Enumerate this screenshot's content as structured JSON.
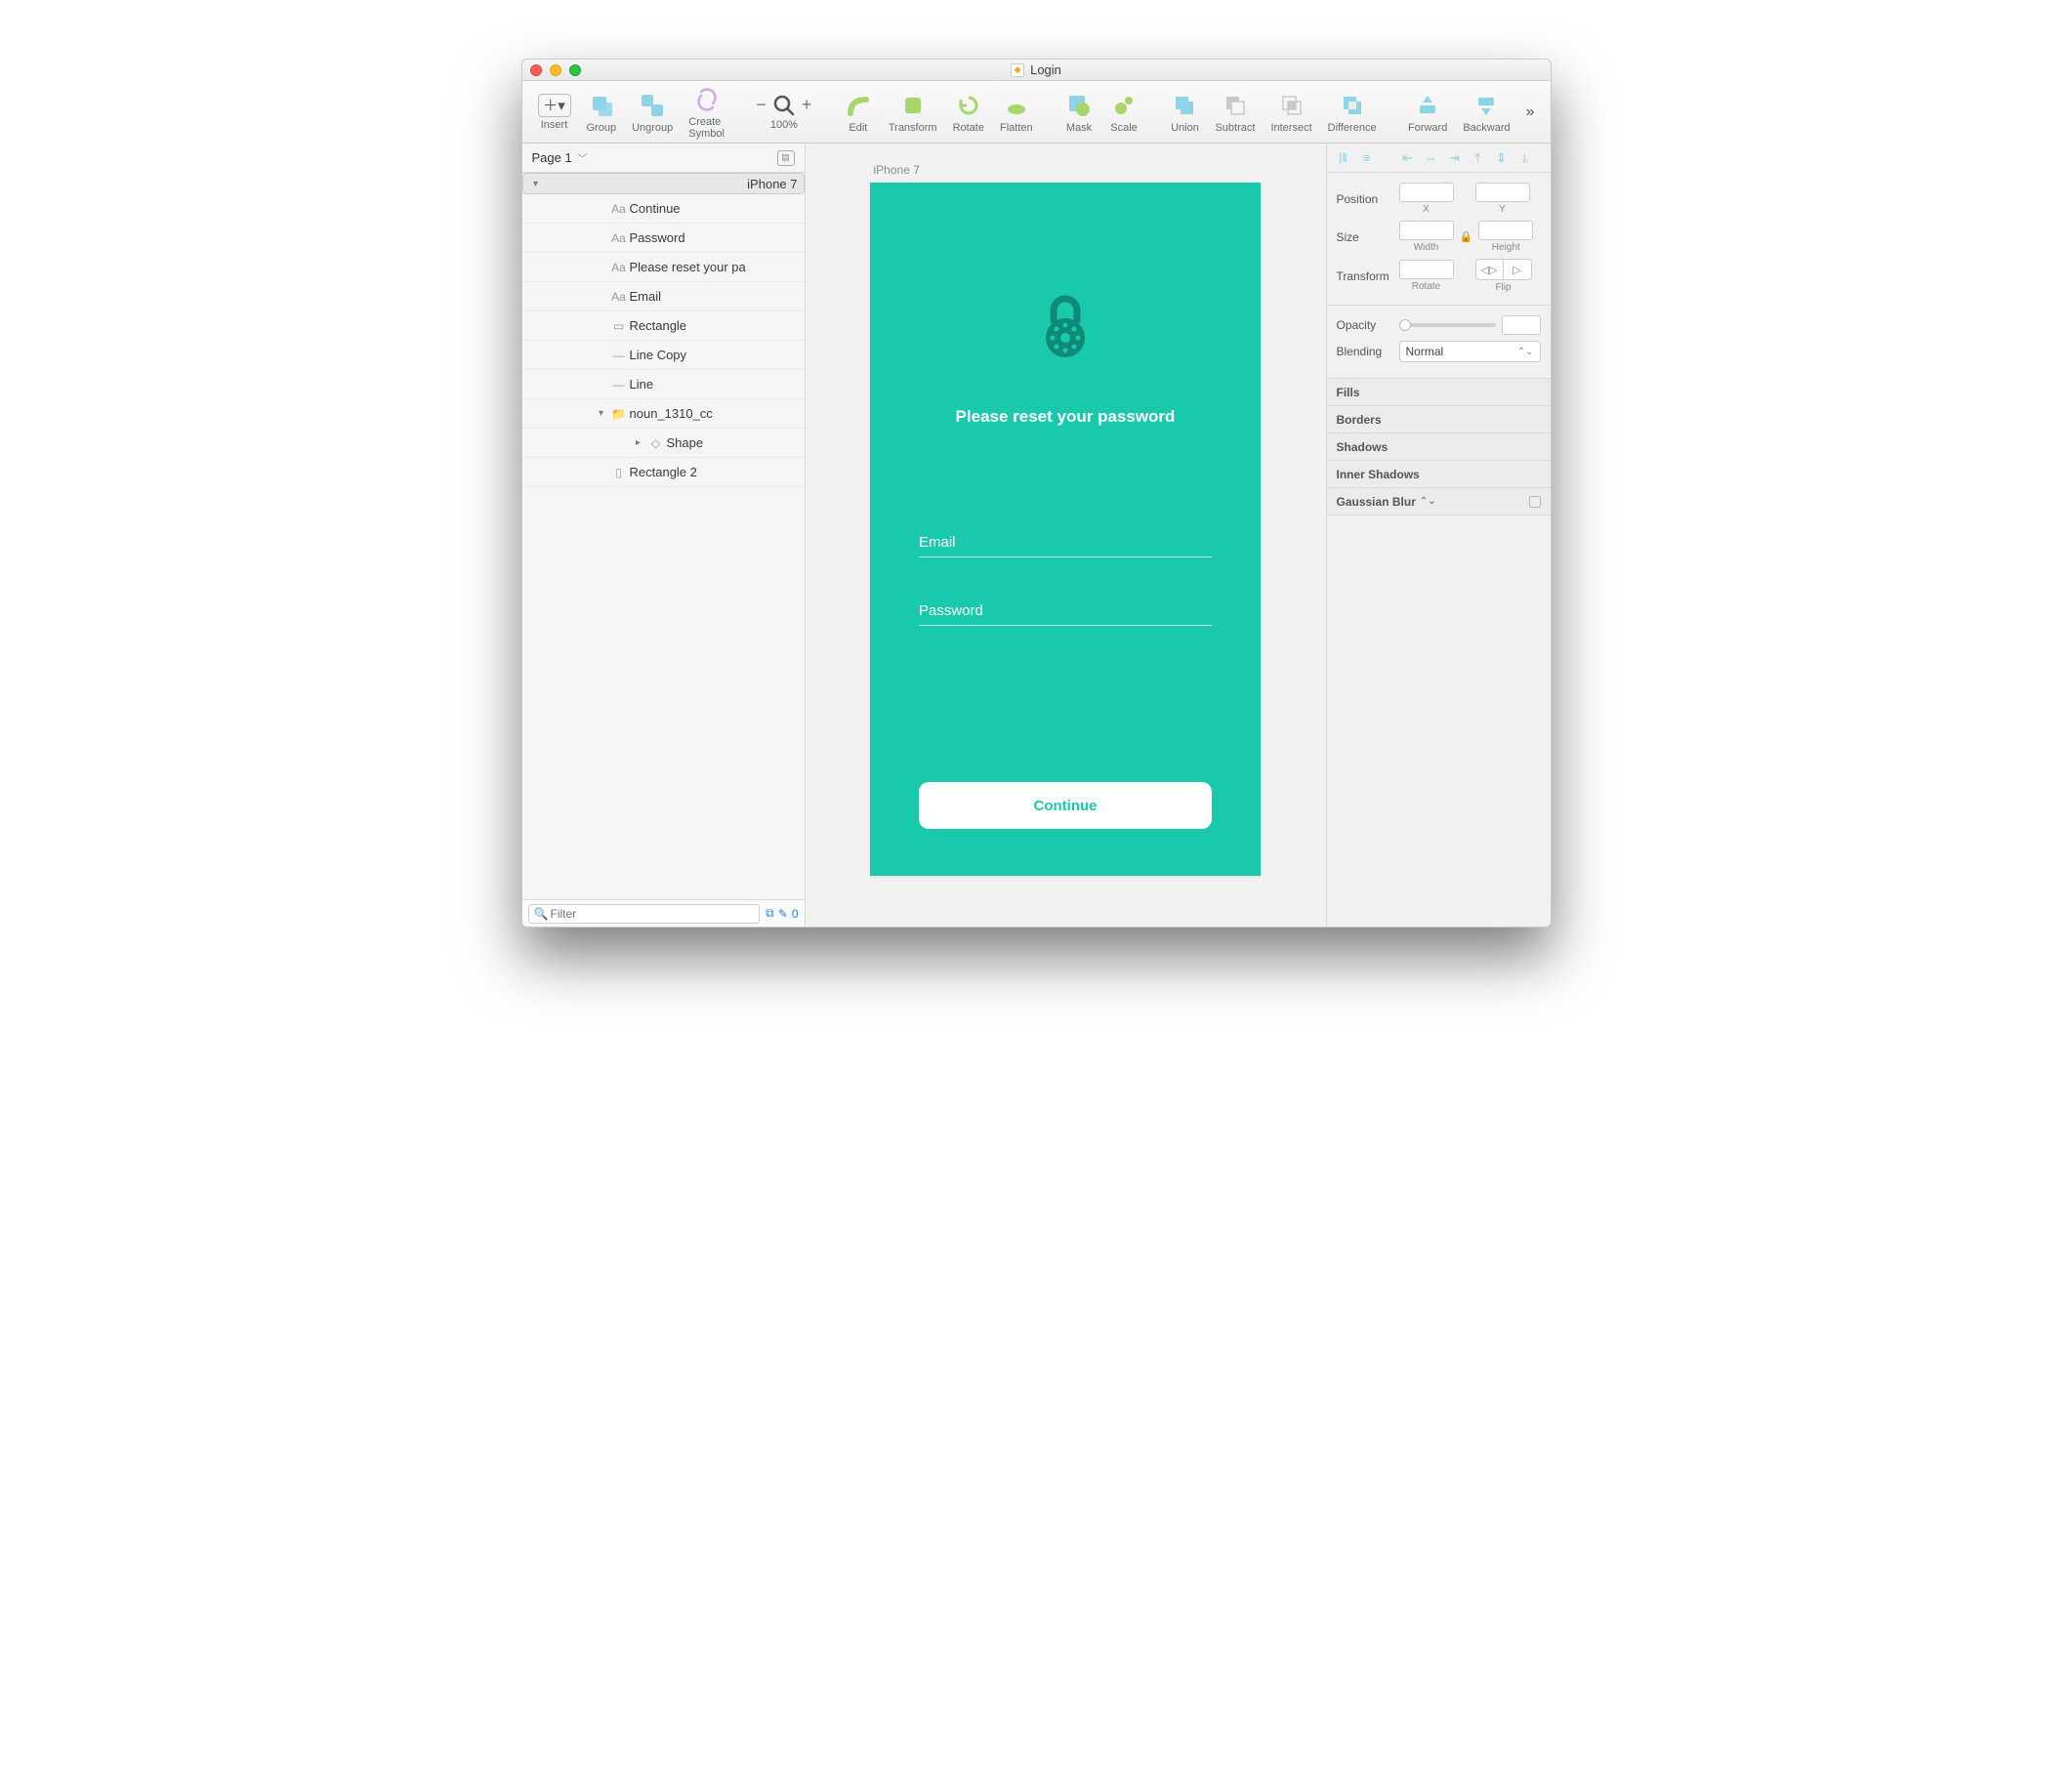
{
  "window": {
    "title": "Login"
  },
  "toolbar": {
    "items": [
      "Insert",
      "Group",
      "Ungroup",
      "Create Symbol"
    ],
    "zoom": "100%",
    "items2": [
      "Edit",
      "Transform",
      "Rotate",
      "Flatten"
    ],
    "items3": [
      "Mask",
      "Scale"
    ],
    "items4": [
      "Union",
      "Subtract",
      "Intersect",
      "Difference"
    ],
    "items5": [
      "Forward",
      "Backward"
    ]
  },
  "pages": {
    "current": "Page 1"
  },
  "layers": [
    {
      "label": "iPhone 7",
      "type": "artboard",
      "depth": 0,
      "disc": "▾"
    },
    {
      "label": "Continue",
      "type": "text",
      "depth": 1
    },
    {
      "label": "Password",
      "type": "text",
      "depth": 1
    },
    {
      "label": "Please reset your pa",
      "type": "text",
      "depth": 1
    },
    {
      "label": "Email",
      "type": "text",
      "depth": 1
    },
    {
      "label": "Rectangle",
      "type": "shape",
      "depth": 1,
      "icon": "▭"
    },
    {
      "label": "Line Copy",
      "type": "shape",
      "depth": 1,
      "icon": "—"
    },
    {
      "label": "Line",
      "type": "shape",
      "depth": 1,
      "icon": "—"
    },
    {
      "label": "noun_1310_cc",
      "type": "folder",
      "depth": 1,
      "disc": "▾"
    },
    {
      "label": "Shape",
      "type": "shape",
      "depth": 2,
      "disc": "▸",
      "icon": "◇"
    },
    {
      "label": "Rectangle 2",
      "type": "shape",
      "depth": 1,
      "icon": "▯"
    }
  ],
  "filter": {
    "placeholder": "Filter",
    "count": "0"
  },
  "canvas": {
    "artboard_label": "iPhone 7",
    "heading": "Please reset your password",
    "field_email": "Email",
    "field_password": "Password",
    "cta": "Continue"
  },
  "inspector": {
    "position": "Position",
    "x": "X",
    "y": "Y",
    "size": "Size",
    "width": "Width",
    "height": "Height",
    "transform": "Transform",
    "rotate": "Rotate",
    "flip": "Flip",
    "opacity_label": "Opacity",
    "blending_label": "Blending",
    "blending_value": "Normal",
    "sections": [
      "Fills",
      "Borders",
      "Shadows",
      "Inner Shadows",
      "Gaussian Blur"
    ]
  }
}
